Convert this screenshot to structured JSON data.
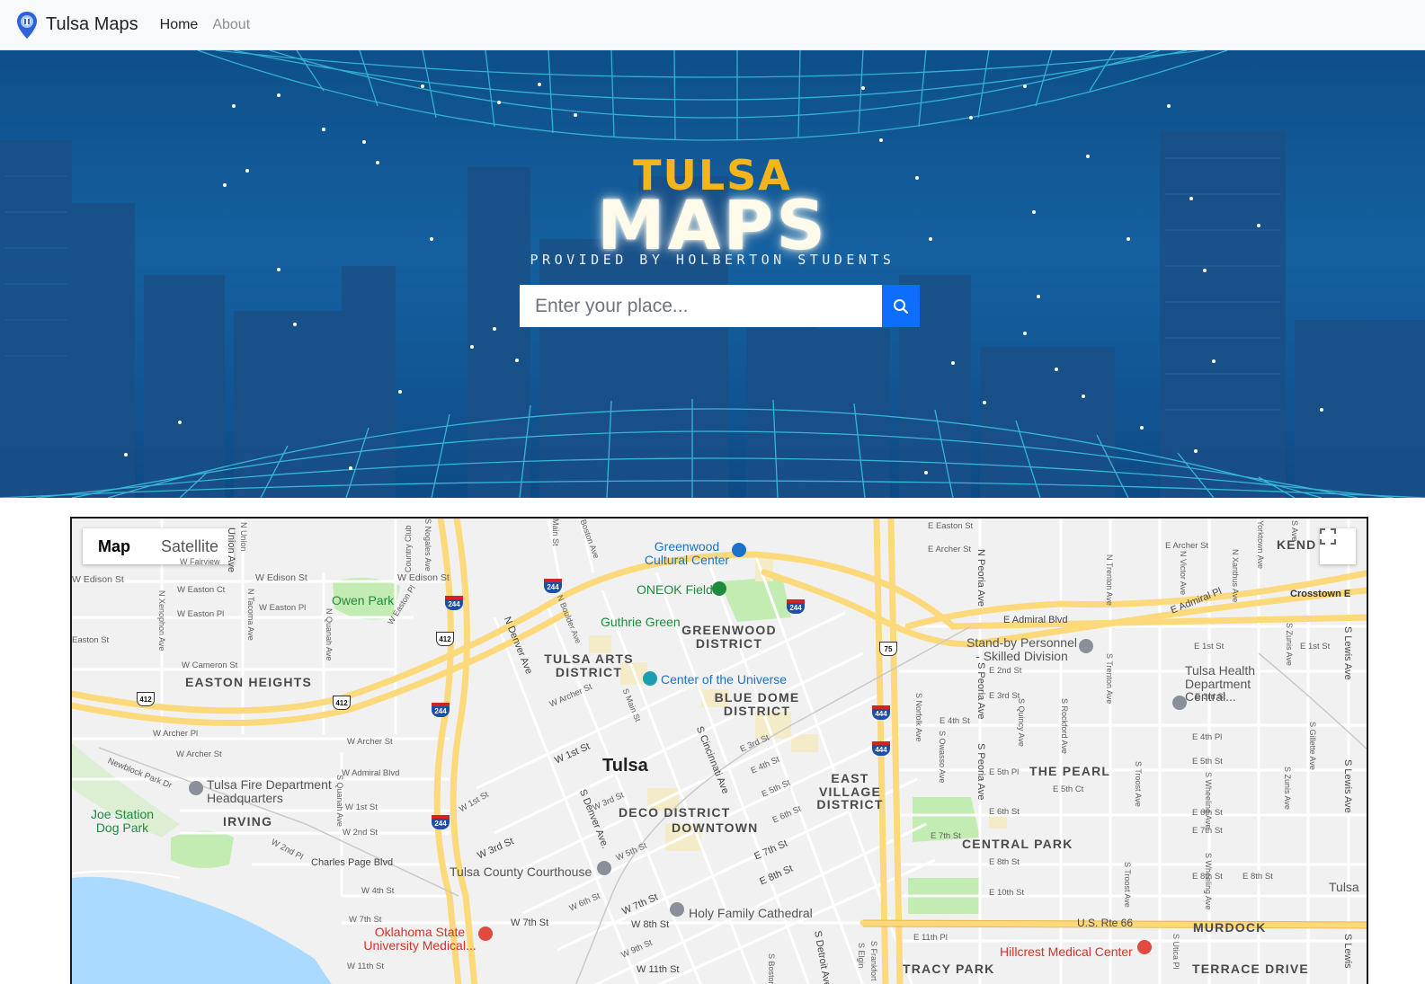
{
  "navbar": {
    "brand": "Tulsa Maps",
    "links": [
      {
        "label": "Home",
        "active": true
      },
      {
        "label": "About",
        "active": false
      }
    ]
  },
  "hero": {
    "title_top": "TULSA",
    "title_main": "MAPS",
    "subtitle": "PROVIDED BY HOLBERTON STUDENTS",
    "search": {
      "placeholder": "Enter your place...",
      "icon": "search-icon"
    }
  },
  "map": {
    "type_options": [
      "Map",
      "Satellite"
    ],
    "selected_type": "Map",
    "fullscreen_icon": "fullscreen-icon",
    "city": "Tulsa",
    "districts": [
      "EASTON HEIGHTS",
      "TULSA ARTS DISTRICT",
      "GREENWOOD DISTRICT",
      "BLUE DOME DISTRICT",
      "EAST VILLAGE DISTRICT",
      "DECO DISTRICT",
      "DOWNTOWN",
      "IRVING",
      "THE PEARL",
      "CENTRAL PARK",
      "MURDOCK",
      "TRACY PARK",
      "TERRACE DRIVE",
      "KEND"
    ],
    "pois": {
      "greenwood_cultural_center": "Greenwood Cultural Center",
      "oneok_field": "ONEOK Field",
      "guthrie_green": "Guthrie Green",
      "center_of_universe": "Center of the Universe",
      "owen_park": "Owen Park",
      "standby_personnel": "Stand-by Personnel - Skilled Division",
      "tulsa_health": "Tulsa Health Department Central...",
      "tulsa_fire": "Tulsa Fire Department Headquarters",
      "joe_station": "Joe Station Dog Park",
      "courthouse": "Tulsa County Courthouse",
      "holy_family": "Holy Family Cathedral",
      "osu_medical": "Oklahoma State University Medical...",
      "hillcrest": "Hillcrest Medical Center",
      "tulsa_edge": "Tulsa",
      "crosstown": "Crosstown E"
    },
    "streets": [
      "W Edison St",
      "W Edison St",
      "W Edison St",
      "W Easton Ct",
      "W Easton Pl",
      "W Easton Pl",
      "Easton St",
      "W Cameron St",
      "W Archer Pl",
      "W Archer St",
      "W Archer St",
      "Newblock Park Dr",
      "W Admiral Blvd",
      "W 1st St",
      "W 2nd St",
      "W 2nd Pl",
      "Charles Page Blvd",
      "W 4th St",
      "W 7th St",
      "W 7th St",
      "W 11th St",
      "W 1st St",
      "W 1st St",
      "W 3rd St",
      "W 3rd St",
      "W 5th St",
      "W 6th St",
      "W 7th St",
      "W 8th St",
      "W 9th St",
      "W 11th St",
      "W Archer St",
      "E 3rd St",
      "E 4th St",
      "E 5th St",
      "E 6th St",
      "E 7th St",
      "E 8th St",
      "E Easton St",
      "E Archer St",
      "E Admiral Blvd",
      "E 2nd St",
      "E 3rd St",
      "E 4th St",
      "E 5th Pl",
      "E 5th Ct",
      "E 6th St",
      "E 7th St",
      "E 8th St",
      "E 10th St",
      "E 11th Pl",
      "E Archer St",
      "E Admiral Pl",
      "E 1st St",
      "E 1st St",
      "E 3rd St",
      "E 4th Pl",
      "E 5th St",
      "E 6th St",
      "E 7th St",
      "E 8th St",
      "E 8th St",
      "U.S. Rte 66",
      "Union Ave",
      "N Union",
      "Country Club",
      "W Fairview",
      "N Xenophon Ave",
      "N Tacoma Ave",
      "N Quanah Ave",
      "W Easton Pl",
      "S Quanah Ave",
      "S Nogales Ave",
      "Main St",
      "Boston Ave",
      "N Denver Ave",
      "N Boulder Ave",
      "S Main St",
      "S Denver Ave.",
      "S Cincinnati Ave",
      "S Boston",
      "S Detroit Ave",
      "S Elgin",
      "S Frankfort",
      "N Peoria Ave",
      "S Peoria Ave",
      "S Peoria Ave",
      "S Norfolk Ave",
      "S Owasso Ave",
      "S Quincy Ave",
      "S Rockford Ave",
      "S Troost Ave",
      "S Troost Ave",
      "N Trenton Ave",
      "S Trenton Ave",
      "N Victor Ave",
      "N Xanthus Ave",
      "Yorktown Ave",
      "S Wheeling Ave",
      "S Wheeling Ave",
      "S Zunis Ave",
      "S Zunis Ave",
      "S Gillette Ave",
      "S Lewis Ave",
      "S Lewis Ave",
      "S Lewis",
      "S Utica Pl",
      "S Ave"
    ],
    "shields": {
      "i244": "244",
      "i444": "444",
      "us412": "412",
      "us75": "75"
    }
  },
  "colors": {
    "primary": "#0d6efd",
    "tulsa_gold": "#f3b51b",
    "hero_blue": "#15609f",
    "highway": "#fcd97a",
    "water": "#aadaff",
    "park": "#c3ecb2"
  }
}
